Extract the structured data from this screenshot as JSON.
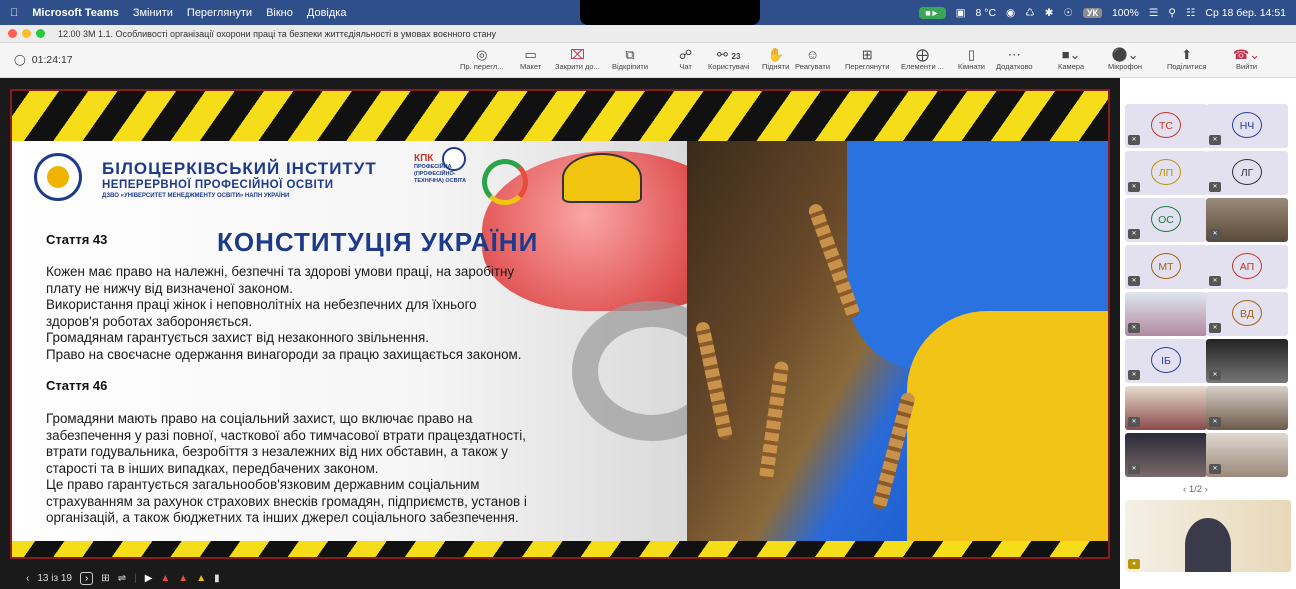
{
  "menubar": {
    "app": "Microsoft Teams",
    "items": [
      "Змінити",
      "Переглянути",
      "Вікно",
      "Довідка"
    ],
    "weather": "8 °C",
    "lang": "УК",
    "battery": "100%",
    "datetime": "Ср 18 бер. 14:51"
  },
  "window": {
    "title": "12.00 3М 1.1. Особливості організації охорони праці та безпеки життєдіяльності в умовах воєнного стану"
  },
  "toolbar": {
    "timer": "01:24:17",
    "buttons": [
      {
        "icon": "eye-icon",
        "label": "Пр. перегл..."
      },
      {
        "icon": "layout-icon",
        "label": "Макет"
      },
      {
        "icon": "close-share-icon",
        "label": "Закрити до..."
      },
      {
        "icon": "popout-icon",
        "label": "Відкріпити"
      },
      {
        "icon": "chat-icon",
        "label": "Чат"
      },
      {
        "icon": "people-icon",
        "label": "Користувачі",
        "count": "23"
      },
      {
        "icon": "raise-hand-icon",
        "label": "Підняти"
      },
      {
        "icon": "react-icon",
        "label": "Реагувати"
      },
      {
        "icon": "view-icon",
        "label": "Переглянути"
      },
      {
        "icon": "apps-icon",
        "label": "Елементи ..."
      },
      {
        "icon": "rooms-icon",
        "label": "Кімнати"
      },
      {
        "icon": "more-icon",
        "label": "Додатково"
      },
      {
        "icon": "camera-icon",
        "label": "Камера"
      },
      {
        "icon": "mic-icon",
        "label": "Мікрофон"
      },
      {
        "icon": "share-icon",
        "label": "Поділитися"
      },
      {
        "icon": "leave-icon",
        "label": "Вийти"
      }
    ]
  },
  "slide": {
    "institute_line1": "БІЛОЦЕРКІВСЬКИЙ ІНСТИТУТ",
    "institute_line2": "НЕПЕРЕРВНОЇ ПРОФЕСІЙНОЇ ОСВІТИ",
    "institute_line3": "ДЗВО «УНІВЕРСИТЕТ МЕНЕДЖМЕНТУ ОСВІТИ» НАПН УКРАЇНИ",
    "kpk": "КПК",
    "kpk_sub1": "ПРОФЕСІЙНА",
    "kpk_sub2": "(ПРОФЕСІЙНО-",
    "kpk_sub3": "ТЕХНІЧНА) ОСВІТА",
    "article1": "Стаття 43",
    "title": "КОНСТИТУЦІЯ УКРАЇНИ",
    "article1_lines": [
      "Кожен має право на належні, безпечні та здорові умови праці, на заробітну",
      "плату не нижчу від визначеної законом.",
      "Використання праці жінок і неповнолітніх на небезпечних для їхнього",
      "здоров'я роботах забороняється.",
      "Громадянам гарантується захист від незаконного звільнення.",
      "Право на своєчасне одержання винагороди за працю захищається законом."
    ],
    "article2": "Стаття 46",
    "article2_lines": [
      "Громадяни мають право на соціальний захист, що включає право на",
      "забезпечення у разі повної, часткової або тимчасової втрати працездатності,",
      "втрати годувальника, безробіття з незалежних від них обставин, а також у",
      "старості та в інших випадках, передбачених законом.",
      "Це право гарантується загальнообов'язковим державним соціальним",
      "страхуванням за рахунок страхових внесків громадян, підприємств, установ і",
      "організацій, а також бюджетних та інших джерел соціального забезпечення."
    ]
  },
  "slide_controls": {
    "page": "13 із 19"
  },
  "participants": [
    {
      "initials": "ТС",
      "color": "#c0392b"
    },
    {
      "initials": "НЧ",
      "color": "#2c3e9a"
    },
    {
      "initials": "ЛП",
      "color": "#b7950b"
    },
    {
      "initials": "ЛГ",
      "color": "#333333"
    },
    {
      "initials": "ОС",
      "color": "#1e7a4a"
    },
    {
      "initials": "",
      "color": "#8a6a4a"
    },
    {
      "initials": "МТ",
      "color": "#a0620a"
    },
    {
      "initials": "АП",
      "color": "#c0392b"
    },
    {
      "initials": "",
      "color": "#b08aa0"
    },
    {
      "initials": "ВД",
      "color": "#a0620a"
    },
    {
      "initials": "ІБ",
      "color": "#2c3e9a"
    },
    {
      "initials": "",
      "color": "#555555"
    },
    {
      "initials": "",
      "color": "#8a4a4a"
    },
    {
      "initials": "",
      "color": "#6a5a4a"
    },
    {
      "initials": "",
      "color": "#7a6a6a"
    },
    {
      "initials": "",
      "color": "#9a8a7a"
    }
  ],
  "gallery_page": "1/2"
}
